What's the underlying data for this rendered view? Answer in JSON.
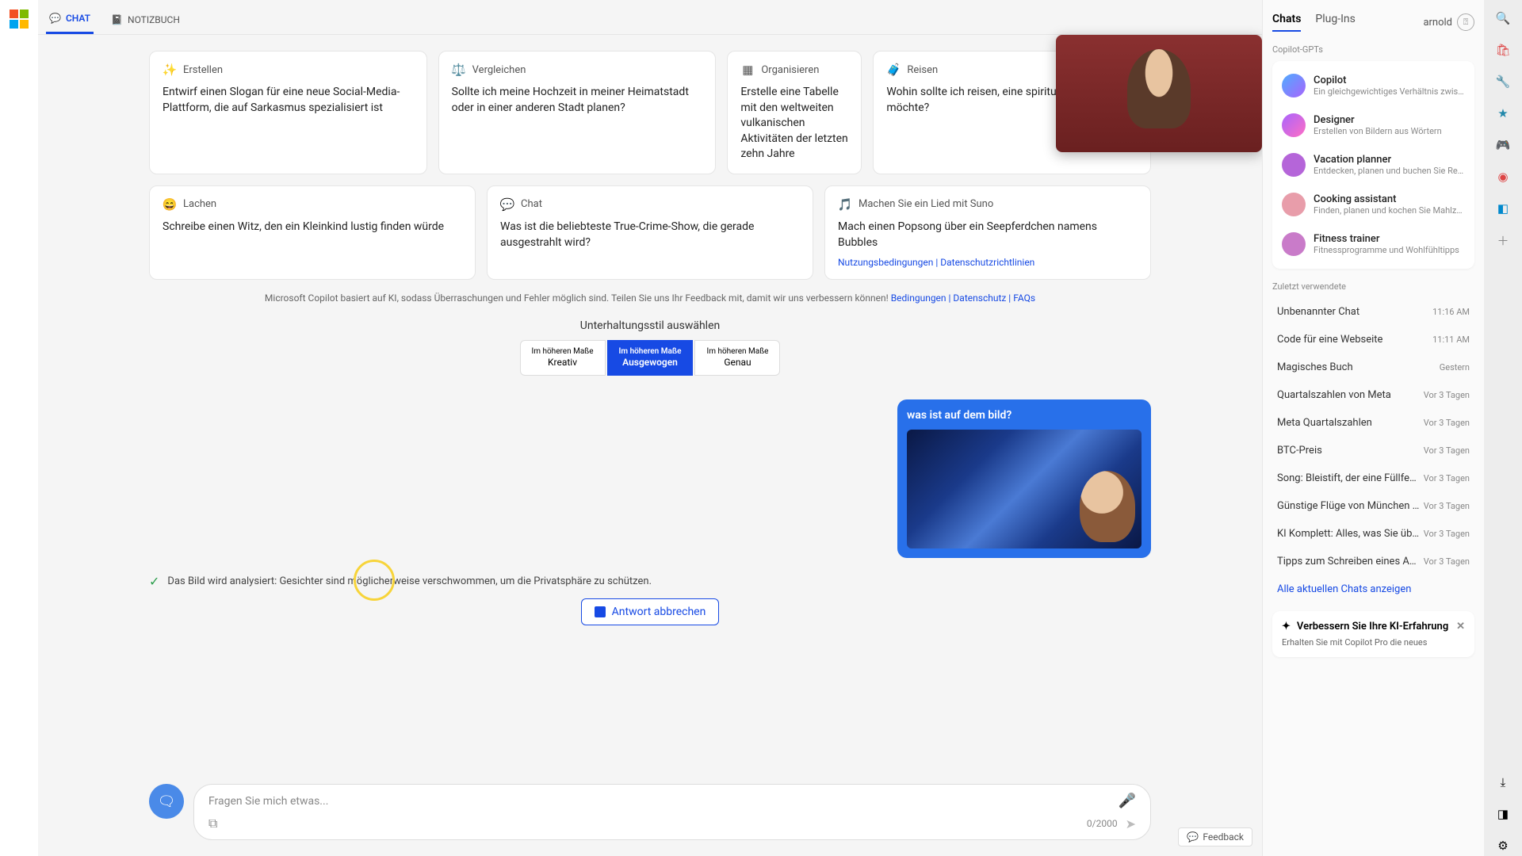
{
  "tabs": {
    "chat": "CHAT",
    "notebook": "NOTIZBUCH"
  },
  "cards_row1": [
    {
      "icon": "✨",
      "title": "Erstellen",
      "body": "Entwirf einen Slogan für eine neue Social-Media-Plattform, die auf Sarkasmus spezialisiert ist"
    },
    {
      "icon": "⚖️",
      "title": "Vergleichen",
      "body": "Sollte ich meine Hochzeit in meiner Heimatstadt oder in einer anderen Stadt planen?"
    },
    {
      "icon": "▦",
      "title": "Organisieren",
      "body": "Erstelle eine Tabelle mit den weltweiten vulkanischen Aktivitäten der letzten zehn Jahre"
    },
    {
      "icon": "🧳",
      "title": "Reisen",
      "body": "Wohin sollte ich reisen, eine spirituelle Erfahrung möchte?"
    }
  ],
  "cards_row2": [
    {
      "icon": "😄",
      "title": "Lachen",
      "body": "Schreibe einen Witz, den ein Kleinkind lustig finden würde"
    },
    {
      "icon": "💬",
      "title": "Chat",
      "body": "Was ist die beliebteste True-Crime-Show, die gerade ausgestrahlt wird?"
    },
    {
      "icon": "🎵",
      "title": "Machen Sie ein Lied mit Suno",
      "body": "Mach einen Popsong über ein Seepferdchen namens Bubbles",
      "links": "Nutzungsbedingungen | Datenschutzrichtlinien"
    }
  ],
  "disclaimer": {
    "text": "Microsoft Copilot basiert auf KI, sodass Überraschungen und Fehler möglich sind. Teilen Sie uns Ihr Feedback mit, damit wir uns verbessern können!",
    "links": "Bedingungen | Datenschutz | FAQs"
  },
  "style": {
    "title": "Unterhaltungsstil auswählen",
    "top": "Im höheren Maße",
    "opt1": "Kreativ",
    "opt2": "Ausgewogen",
    "opt3": "Genau"
  },
  "user_message": {
    "question": "was ist auf dem bild?"
  },
  "status": "Das Bild wird analysiert: Gesichter sind möglicherweise verschwommen, um die Privatsphäre zu schützen.",
  "cancel": "Antwort abbrechen",
  "input": {
    "placeholder": "Fragen Sie mich etwas...",
    "counter": "0/2000"
  },
  "right": {
    "tabs": {
      "chats": "Chats",
      "plugins": "Plug-Ins"
    },
    "user": "arnold",
    "gpts_label": "Copilot-GPTs",
    "gpts": [
      {
        "name": "Copilot",
        "sub": "Ein gleichgewichtiges Verhältnis zwischen KI u",
        "color": "linear-gradient(135deg,#4facfe,#a864fd)"
      },
      {
        "name": "Designer",
        "sub": "Erstellen von Bildern aus Wörtern",
        "color": "linear-gradient(135deg,#a864fd,#ff6ec4)"
      },
      {
        "name": "Vacation planner",
        "sub": "Entdecken, planen und buchen Sie Reisen",
        "color": "#b565d9"
      },
      {
        "name": "Cooking assistant",
        "sub": "Finden, planen und kochen Sie Mahlzeiten",
        "color": "#e89daa"
      },
      {
        "name": "Fitness trainer",
        "sub": "Fitnessprogramme und Wohlfühltipps",
        "color": "#c97bc9"
      }
    ],
    "recent_label": "Zuletzt verwendete",
    "recents": [
      {
        "t": "Unbenannter Chat",
        "d": "11:16 AM"
      },
      {
        "t": "Code für eine Webseite",
        "d": "11:11 AM"
      },
      {
        "t": "Magisches Buch",
        "d": "Gestern"
      },
      {
        "t": "Quartalszahlen von Meta",
        "d": "Vor 3 Tagen"
      },
      {
        "t": "Meta Quartalszahlen",
        "d": "Vor 3 Tagen"
      },
      {
        "t": "BTC-Preis",
        "d": "Vor 3 Tagen"
      },
      {
        "t": "Song: Bleistift, der eine Füllfeder sein m",
        "d": "Vor 3 Tagen"
      },
      {
        "t": "Günstige Flüge von München nach Fra",
        "d": "Vor 3 Tagen"
      },
      {
        "t": "KI Komplett: Alles, was Sie über LLMs i",
        "d": "Vor 3 Tagen"
      },
      {
        "t": "Tipps zum Schreiben eines Artikels üb",
        "d": "Vor 3 Tagen"
      }
    ],
    "show_all": "Alle aktuellen Chats anzeigen",
    "improve": {
      "title": "Verbessern Sie Ihre KI-Erfahrung",
      "body": "Erhalten Sie mit Copilot Pro die neues"
    }
  },
  "feedback": "Feedback"
}
